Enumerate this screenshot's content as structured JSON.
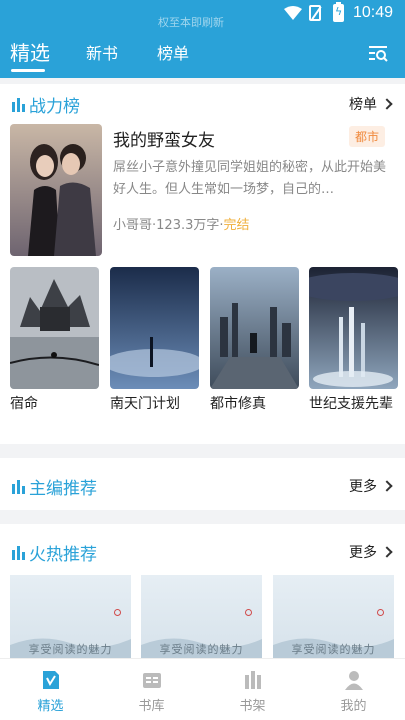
{
  "status_bar": {
    "time": "10:49",
    "ghost_text": "权至本即刷新"
  },
  "top_tabs": [
    {
      "label": "精选",
      "active": true
    },
    {
      "label": "新书",
      "active": false
    },
    {
      "label": "榜单",
      "active": false
    }
  ],
  "power_rank": {
    "title": "战力榜",
    "more_label": "榜单",
    "featured": {
      "title": "我的野蛮女友",
      "tag": "都市",
      "description": "屌丝小子意外撞见同学姐姐的秘密，从此开始美好人生。但人生常如一场梦，自己的…",
      "author": "小哥哥",
      "words": "123.3万字",
      "status": "完结"
    },
    "books": [
      {
        "name": "宿命"
      },
      {
        "name": "南天门计划"
      },
      {
        "name": "都市修真"
      },
      {
        "name": "世纪支援先辈"
      }
    ]
  },
  "editor_pick": {
    "title": "主编推荐",
    "more_label": "更多"
  },
  "hot_pick": {
    "title": "火热推荐",
    "more_label": "更多",
    "slogans": [
      "享受阅读的魅力",
      "享受阅读的魅力",
      "享受阅读的魅力"
    ]
  },
  "bottom_nav": [
    {
      "label": "精选",
      "active": true
    },
    {
      "label": "书库",
      "active": false
    },
    {
      "label": "书架",
      "active": false
    },
    {
      "label": "我的",
      "active": false
    }
  ],
  "colors": {
    "accent": "#2aa2d8",
    "tag": "#f08a3e",
    "status": "#f0b03c"
  }
}
